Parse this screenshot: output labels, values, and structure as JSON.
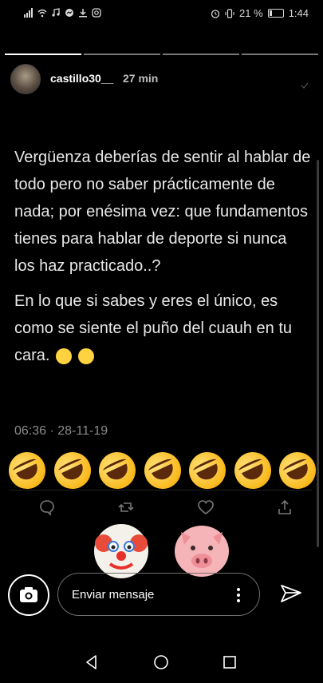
{
  "status_bar": {
    "battery_percent": "21 %",
    "time": "1:44",
    "left_icons": [
      "signal-icon",
      "wifi-icon",
      "music-icon",
      "messenger-icon",
      "download-icon",
      "instagram-icon"
    ],
    "right_icons": [
      "alarm-icon",
      "vibrate-icon",
      "battery-icon"
    ]
  },
  "story": {
    "segments_total": 4,
    "segments_viewed": 1,
    "username": "castillo30__",
    "time_ago": "27 min"
  },
  "tweet": {
    "paragraph1": "Vergüenza deberías de sentir al hablar de todo pero no saber prácticamente de nada; por enésima vez: que fundamentos tienes para hablar de deporte si nunca los haz practicado..?",
    "paragraph2": "En lo que si sabes y eres el único, es como se siente el puño del cuauh en tu cara.",
    "paragraph2_emoji": [
      "face-with-tears-of-joy",
      "face-with-tears-of-joy"
    ],
    "date": "06:36 · 28-11-19",
    "rofl_count": 7,
    "action_icons": [
      "reply-icon",
      "retweet-icon",
      "like-icon",
      "share-icon"
    ]
  },
  "reactions": [
    "clown-face",
    "pig-face"
  ],
  "message_bar": {
    "placeholder": "Enviar mensaje"
  },
  "colors": {
    "background": "#000000",
    "text": "#e8e8e8",
    "muted": "#8a8a8a"
  }
}
